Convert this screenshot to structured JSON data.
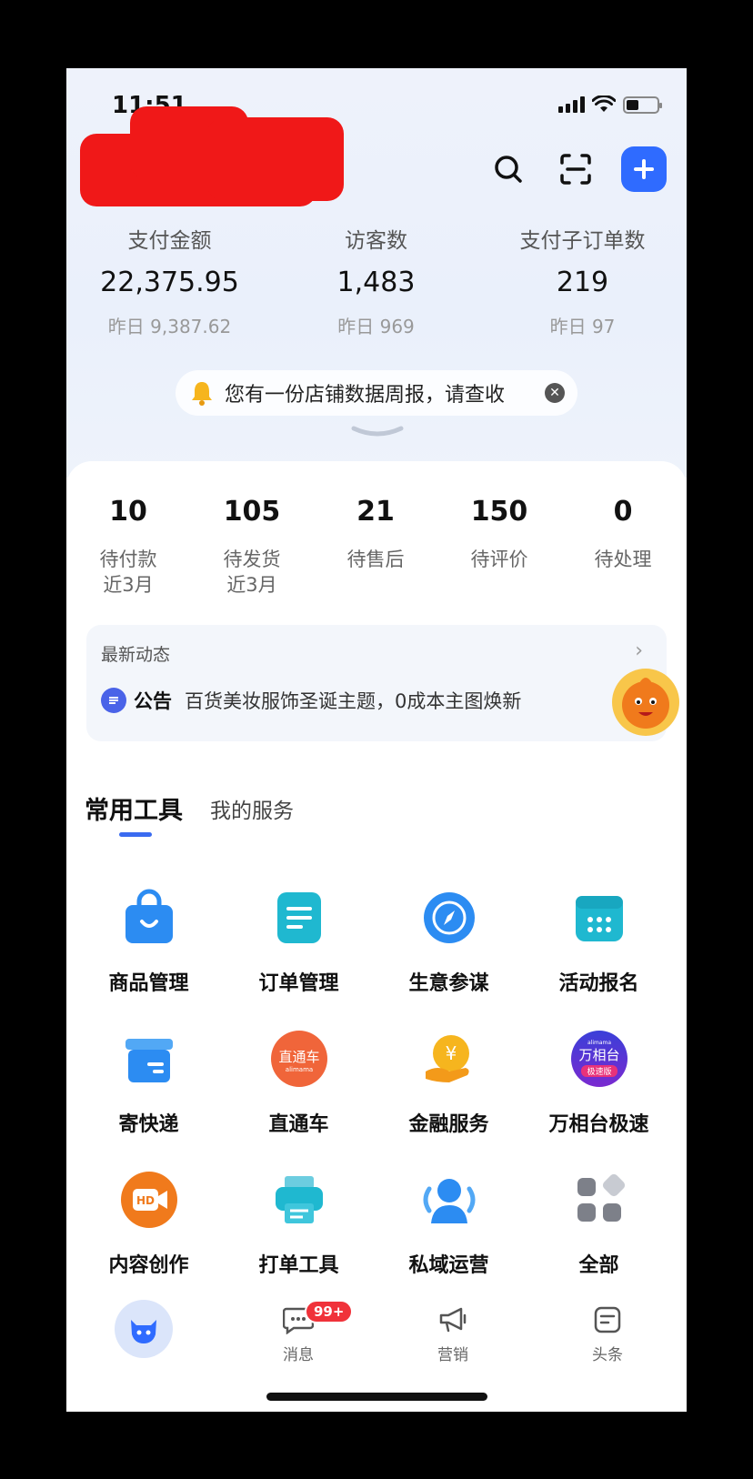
{
  "status": {
    "time": "11:51"
  },
  "metrics": [
    {
      "label": "支付金额",
      "value": "22,375.95",
      "yesterday": "昨日 9,387.62"
    },
    {
      "label": "访客数",
      "value": "1,483",
      "yesterday": "昨日 969"
    },
    {
      "label": "支付子订单数",
      "value": "219",
      "yesterday": "昨日 97"
    }
  ],
  "notice": {
    "text": "您有一份店铺数据周报，请查收"
  },
  "orders": [
    {
      "num": "10",
      "label": "待付款",
      "sub": "近3月"
    },
    {
      "num": "105",
      "label": "待发货",
      "sub": "近3月"
    },
    {
      "num": "21",
      "label": "待售后",
      "sub": ""
    },
    {
      "num": "150",
      "label": "待评价",
      "sub": ""
    },
    {
      "num": "0",
      "label": "待处理",
      "sub": ""
    }
  ],
  "news": {
    "title": "最新动态",
    "tag": "公告",
    "message": "百货美妆服饰圣诞主题，0成本主图焕新"
  },
  "tabs": {
    "active": "常用工具",
    "other": "我的服务"
  },
  "tools": [
    {
      "name": "商品管理",
      "icon": "shopping-bag-icon"
    },
    {
      "name": "订单管理",
      "icon": "document-icon"
    },
    {
      "name": "生意参谋",
      "icon": "compass-icon"
    },
    {
      "name": "活动报名",
      "icon": "calendar-icon"
    },
    {
      "name": "寄快递",
      "icon": "package-box-icon"
    },
    {
      "name": "直通车",
      "icon": "ztc-logo-icon",
      "logo_text": "直通车",
      "logo_sub": "alimama"
    },
    {
      "name": "金融服务",
      "icon": "finance-coin-icon"
    },
    {
      "name": "万相台极速",
      "icon": "wxt-logo-icon",
      "logo_text": "万相台",
      "logo_sub": "极速版",
      "logo_top": "alimama"
    },
    {
      "name": "内容创作",
      "icon": "hd-video-icon",
      "logo_text": "HD"
    },
    {
      "name": "打单工具",
      "icon": "printer-icon"
    },
    {
      "name": "私域运营",
      "icon": "people-icon"
    },
    {
      "name": "全部",
      "icon": "all-apps-icon"
    }
  ],
  "tabbar": [
    {
      "label": "",
      "icon": "home-mascot-icon"
    },
    {
      "label": "消息",
      "icon": "message-icon",
      "badge": "99+"
    },
    {
      "label": "营销",
      "icon": "megaphone-icon"
    },
    {
      "label": "头条",
      "icon": "headline-icon"
    }
  ],
  "colors": {
    "accent": "#2f6bff",
    "badge": "#f0323a",
    "redaction": "#f01818"
  }
}
